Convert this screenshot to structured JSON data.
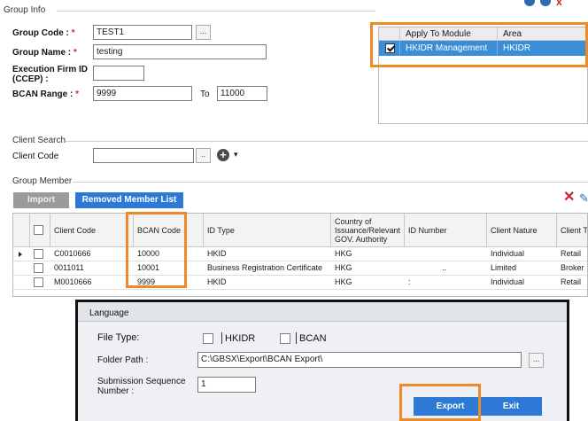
{
  "group_info": {
    "section_title": "Group Info",
    "group_code_label": "Group Code :",
    "group_code_value": "TEST1",
    "group_name_label": "Group Name :",
    "group_name_value": "testing",
    "exec_firm_label_1": "Execution Firm ID",
    "exec_firm_label_2": "(CCEP) :",
    "exec_firm_value": "",
    "bcan_range_label": "BCAN Range :",
    "bcan_from": "9999",
    "to_label": "To",
    "bcan_to": "11000",
    "required_mark": "*",
    "ellipsis": "..."
  },
  "module_grid": {
    "headers": [
      "Apply To Module",
      "Area"
    ],
    "rows": [
      {
        "checked": true,
        "module": "HKIDR Management",
        "area": "HKIDR"
      }
    ]
  },
  "client_search": {
    "section_title": "Client Search",
    "client_code_label": "Client Code",
    "client_code_value": "",
    "ellipsis": "..",
    "dropdown_glyph": "▾"
  },
  "group_member": {
    "section_title": "Group Member",
    "import_label": "Import",
    "removed_member_label": "Removed Member List",
    "columns": [
      "Client Code",
      "BCAN Code",
      "ID Type",
      "Country of Issuance/Relevant GOV. Authority",
      "ID Number",
      "Client Nature",
      "Client Ty"
    ],
    "rows": [
      {
        "client_code": "C0010666",
        "bcan": "10000",
        "id_type": "HKID",
        "country": "HKG",
        "id_number": "",
        "nature": "Individual",
        "client_type": "Retail"
      },
      {
        "client_code": "0011011",
        "bcan": "10001",
        "id_type": "Business Registration Certificate",
        "country": "HKG",
        "id_number": "..",
        "nature": "Limited",
        "client_type": "Broker"
      },
      {
        "client_code": "M0010666",
        "bcan": "9999",
        "id_type": "HKID",
        "country": "HKG",
        "id_number": ":",
        "nature": "Individual",
        "client_type": "Retail"
      }
    ]
  },
  "language_dialog": {
    "title": "Language",
    "file_type_label": "File Type:",
    "option_hkidr": "HKIDR",
    "option_bcan": "BCAN",
    "folder_path_label": "Folder Path :",
    "folder_path_value": "C:\\GBSX\\Export\\BCAN Export\\",
    "submission_label_1": "Submission Sequence",
    "submission_label_2": "Number :",
    "submission_value": "1",
    "export_label": "Export",
    "exit_label": "Exit",
    "ellipsis": "..."
  },
  "colors": {
    "accent_blue": "#2d7ad6",
    "selection_blue": "#3a8ed8",
    "highlight_orange": "#f08a24",
    "required_red": "#d2262c"
  }
}
